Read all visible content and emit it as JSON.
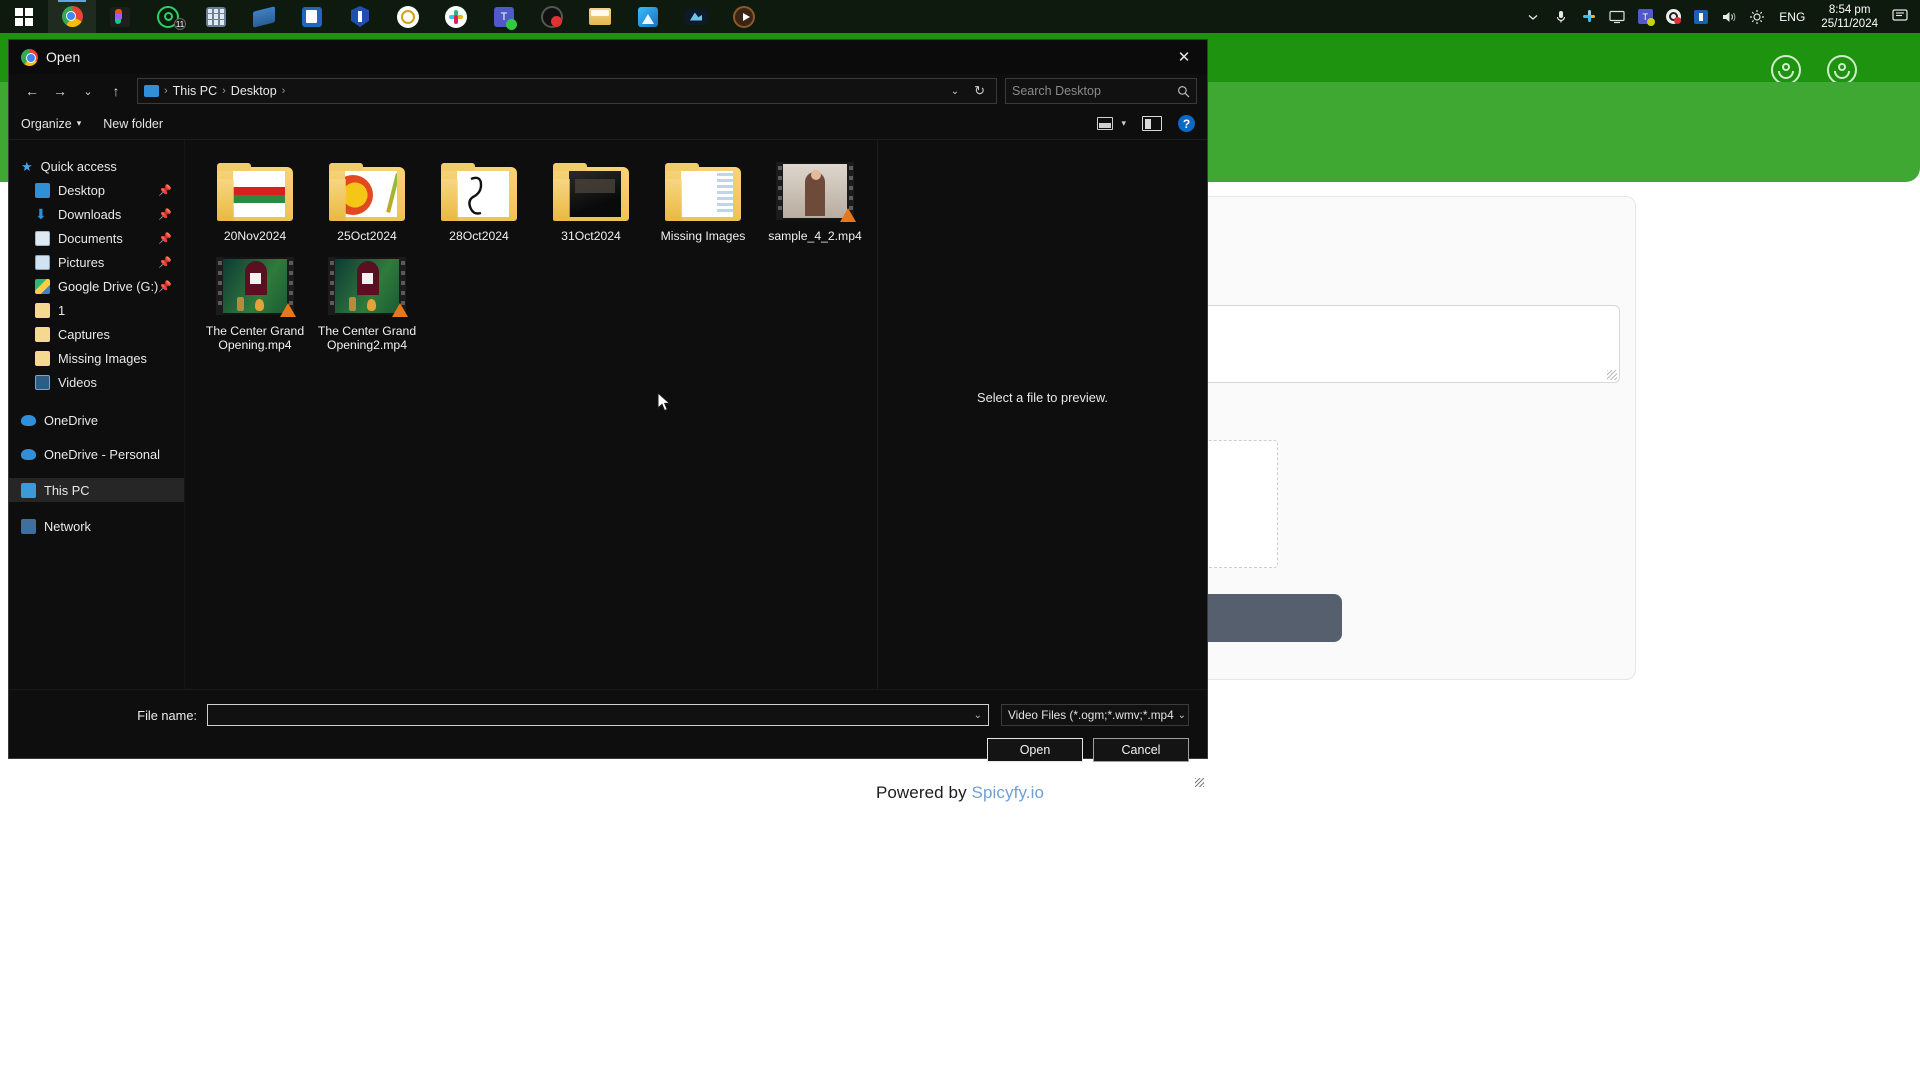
{
  "taskbar": {
    "start_label": "Start",
    "apps": [
      {
        "name": "start-button",
        "icon": "windows-icon"
      },
      {
        "name": "taskbar-item-chrome",
        "icon": "chrome-icon",
        "active": true
      },
      {
        "name": "taskbar-item-figma",
        "icon": "figma-icon"
      },
      {
        "name": "taskbar-item-whatsapp",
        "icon": "whatsapp-icon",
        "badge": "11"
      },
      {
        "name": "taskbar-item-calculator",
        "icon": "calculator-icon"
      },
      {
        "name": "taskbar-item-file-transfer",
        "icon": "file-transfer-icon"
      },
      {
        "name": "taskbar-item-mail",
        "icon": "mail-icon"
      },
      {
        "name": "taskbar-item-shield",
        "icon": "shield-icon"
      },
      {
        "name": "taskbar-item-1password",
        "icon": "1password-icon"
      },
      {
        "name": "taskbar-item-slack",
        "icon": "slack-icon"
      },
      {
        "name": "taskbar-item-teams",
        "icon": "teams-icon"
      },
      {
        "name": "taskbar-item-record",
        "icon": "record-icon"
      },
      {
        "name": "taskbar-item-explorer",
        "icon": "folder-icon"
      },
      {
        "name": "taskbar-item-photos",
        "icon": "photos-icon"
      },
      {
        "name": "taskbar-item-editor",
        "icon": "editor-icon"
      },
      {
        "name": "taskbar-item-media-player",
        "icon": "play-icon"
      }
    ],
    "tray": [
      {
        "name": "tray-overflow",
        "icon": "chevron-up-icon"
      },
      {
        "name": "tray-microphone",
        "icon": "microphone-icon"
      },
      {
        "name": "tray-slack",
        "icon": "slack-icon"
      },
      {
        "name": "tray-display",
        "icon": "monitor-icon"
      },
      {
        "name": "tray-teams",
        "icon": "teams-icon"
      },
      {
        "name": "tray-headset",
        "icon": "headset-icon"
      },
      {
        "name": "tray-update",
        "icon": "update-icon"
      },
      {
        "name": "tray-volume",
        "icon": "speaker-icon"
      },
      {
        "name": "tray-brightness",
        "icon": "brightness-icon"
      }
    ],
    "language": "ENG",
    "clock_time": "8:54 pm",
    "clock_date": "25/11/2024",
    "notifications_icon": "notification-icon"
  },
  "background_page": {
    "powered_prefix": "Powered by ",
    "powered_link": "Spicyfy.io",
    "header_color": "#1e9310",
    "band_color": "#3fa832",
    "button_color": "#555f6e"
  },
  "dialog": {
    "title": "Open",
    "app_icon": "chrome-icon",
    "close_label": "✕",
    "nav": {
      "back": "←",
      "forward": "→",
      "recent": "⌄",
      "up": "↑",
      "refresh": "↻",
      "dropdown_caret": "⌄"
    },
    "breadcrumb": {
      "root_icon": "this-pc-icon",
      "items": [
        "This PC",
        "Desktop"
      ],
      "separator": "›",
      "trailing_separator": "›"
    },
    "search": {
      "placeholder": "Search Desktop",
      "icon": "search-icon"
    },
    "toolbar": {
      "organize_label": "Organize",
      "organize_caret": "▾",
      "new_folder_label": "New folder",
      "view_icon": "view-layout-icon",
      "view_caret": "▾",
      "pane_icon": "preview-pane-icon",
      "help_label": "?"
    },
    "sidebar": {
      "items": [
        {
          "label": "Quick access",
          "icon": "star-icon",
          "pinned": false,
          "root": true,
          "selected": false
        },
        {
          "label": "Desktop",
          "icon": "desktop-icon",
          "pinned": true,
          "root": false,
          "selected": false
        },
        {
          "label": "Downloads",
          "icon": "download-icon",
          "pinned": true,
          "root": false,
          "selected": false
        },
        {
          "label": "Documents",
          "icon": "documents-icon",
          "pinned": true,
          "root": false,
          "selected": false
        },
        {
          "label": "Pictures",
          "icon": "pictures-icon",
          "pinned": true,
          "root": false,
          "selected": false
        },
        {
          "label": "Google Drive (G:)",
          "icon": "google-drive-icon",
          "pinned": true,
          "root": false,
          "selected": false
        },
        {
          "label": "1",
          "icon": "folder-icon",
          "pinned": false,
          "root": false,
          "selected": false
        },
        {
          "label": "Captures",
          "icon": "folder-icon",
          "pinned": false,
          "root": false,
          "selected": false
        },
        {
          "label": "Missing Images",
          "icon": "folder-icon",
          "pinned": false,
          "root": false,
          "selected": false
        },
        {
          "label": "Videos",
          "icon": "videos-icon",
          "pinned": false,
          "root": false,
          "selected": false
        },
        {
          "label": "OneDrive",
          "icon": "onedrive-icon",
          "pinned": false,
          "root": true,
          "selected": false
        },
        {
          "label": "OneDrive - Personal",
          "icon": "onedrive-icon",
          "pinned": false,
          "root": true,
          "selected": false
        },
        {
          "label": "This PC",
          "icon": "this-pc-icon",
          "pinned": false,
          "root": true,
          "selected": true
        },
        {
          "label": "Network",
          "icon": "network-icon",
          "pinned": false,
          "root": true,
          "selected": false
        }
      ]
    },
    "files": [
      {
        "label": "20Nov2024",
        "kind": "folder",
        "thumb": "folder-doc-green"
      },
      {
        "label": "25Oct2024",
        "kind": "folder",
        "thumb": "folder-doc-emo"
      },
      {
        "label": "28Oct2024",
        "kind": "folder",
        "thumb": "folder-doc-sketch"
      },
      {
        "label": "31Oct2024",
        "kind": "folder",
        "thumb": "folder-photo-dark"
      },
      {
        "label": "Missing Images",
        "kind": "folder",
        "thumb": "folder-plain"
      },
      {
        "label": "sample_4_2.mp4",
        "kind": "video",
        "thumb": "video-person"
      },
      {
        "label": "The Center Grand Opening.mp4",
        "kind": "video",
        "thumb": "video-scene"
      },
      {
        "label": "The Center Grand Opening2.mp4",
        "kind": "video",
        "thumb": "video-scene"
      }
    ],
    "preview": {
      "message": "Select a file to preview."
    },
    "footer": {
      "file_name_label": "File name:",
      "file_name_value": "",
      "file_name_caret": "⌄",
      "filter_value": "Video Files (*.ogm;*.wmv;*.mp4",
      "filter_caret": "⌄",
      "open_label": "Open",
      "cancel_label": "Cancel"
    }
  }
}
